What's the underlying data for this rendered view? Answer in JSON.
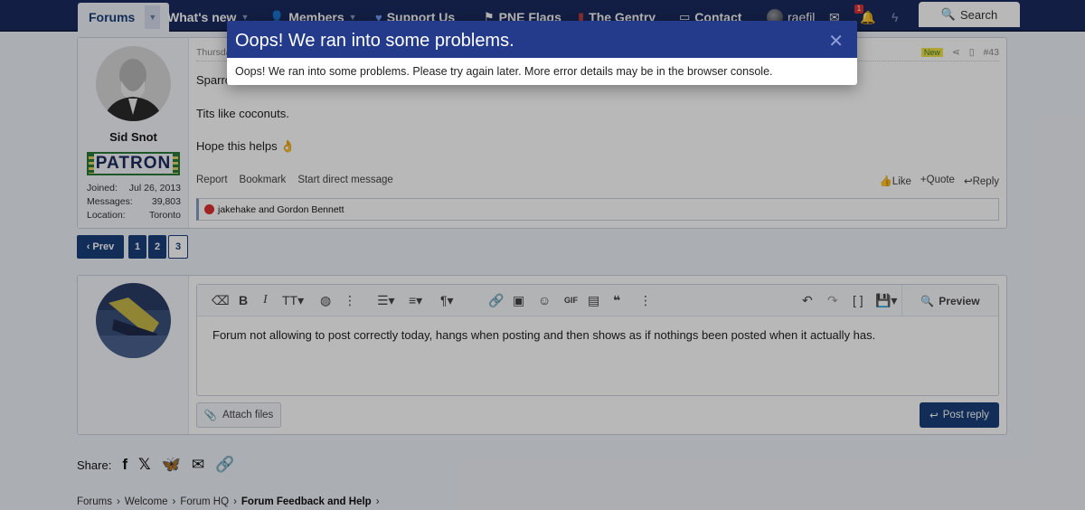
{
  "nav": {
    "tabs": [
      {
        "label": "Forums",
        "icon": ""
      },
      {
        "label": "What's new",
        "icon": ""
      },
      {
        "label": "Members",
        "icon": "person-icon"
      },
      {
        "label": "Support Us",
        "icon": "heart-icon"
      },
      {
        "label": "PNE Flags",
        "icon": "flag-icon"
      },
      {
        "label": "The Gentry",
        "icon": "book-icon"
      },
      {
        "label": "Contact",
        "icon": "card-icon"
      }
    ],
    "username": "raefil",
    "alert_count": "1",
    "search_label": "Search"
  },
  "post": {
    "author": "Sid Snot",
    "banner": "PATRON",
    "stats": [
      {
        "key": "Joined:",
        "value": "Jul 26, 2013"
      },
      {
        "key": "Messages:",
        "value": "39,803"
      },
      {
        "key": "Location:",
        "value": "Toronto"
      }
    ],
    "date": "Thursda",
    "new_badge": "New",
    "post_number": "#43",
    "lines": [
      "Sparro",
      "Tits like coconuts.",
      "Hope this helps 👌"
    ],
    "actions_left": [
      "Report",
      "Bookmark",
      "Start direct message"
    ],
    "actions_right": [
      "Like",
      "+Quote",
      "Reply"
    ],
    "reactions": "jakehake and Gordon Bennett"
  },
  "pagination": {
    "prev": "‹ Prev",
    "pages": [
      "1",
      "2",
      "3"
    ],
    "current": "3"
  },
  "editor": {
    "text": "Forum not allowing to post correctly today, hangs when posting and then shows as if nothings been posted when it actually has.",
    "preview_label": "Preview",
    "attach_label": "Attach files",
    "post_reply_label": "Post reply"
  },
  "share": {
    "label": "Share:"
  },
  "breadcrumb": [
    "Forums",
    "Welcome",
    "Forum HQ",
    "Forum Feedback and Help"
  ],
  "modal": {
    "title": "Oops! We ran into some problems.",
    "message": "Oops! We ran into some problems. Please try again later. More error details may be in the browser console."
  },
  "colors": {
    "nav_bg": "#1a2a5e",
    "modal_header": "#243a8a",
    "button_primary": "#1a3f7a"
  }
}
